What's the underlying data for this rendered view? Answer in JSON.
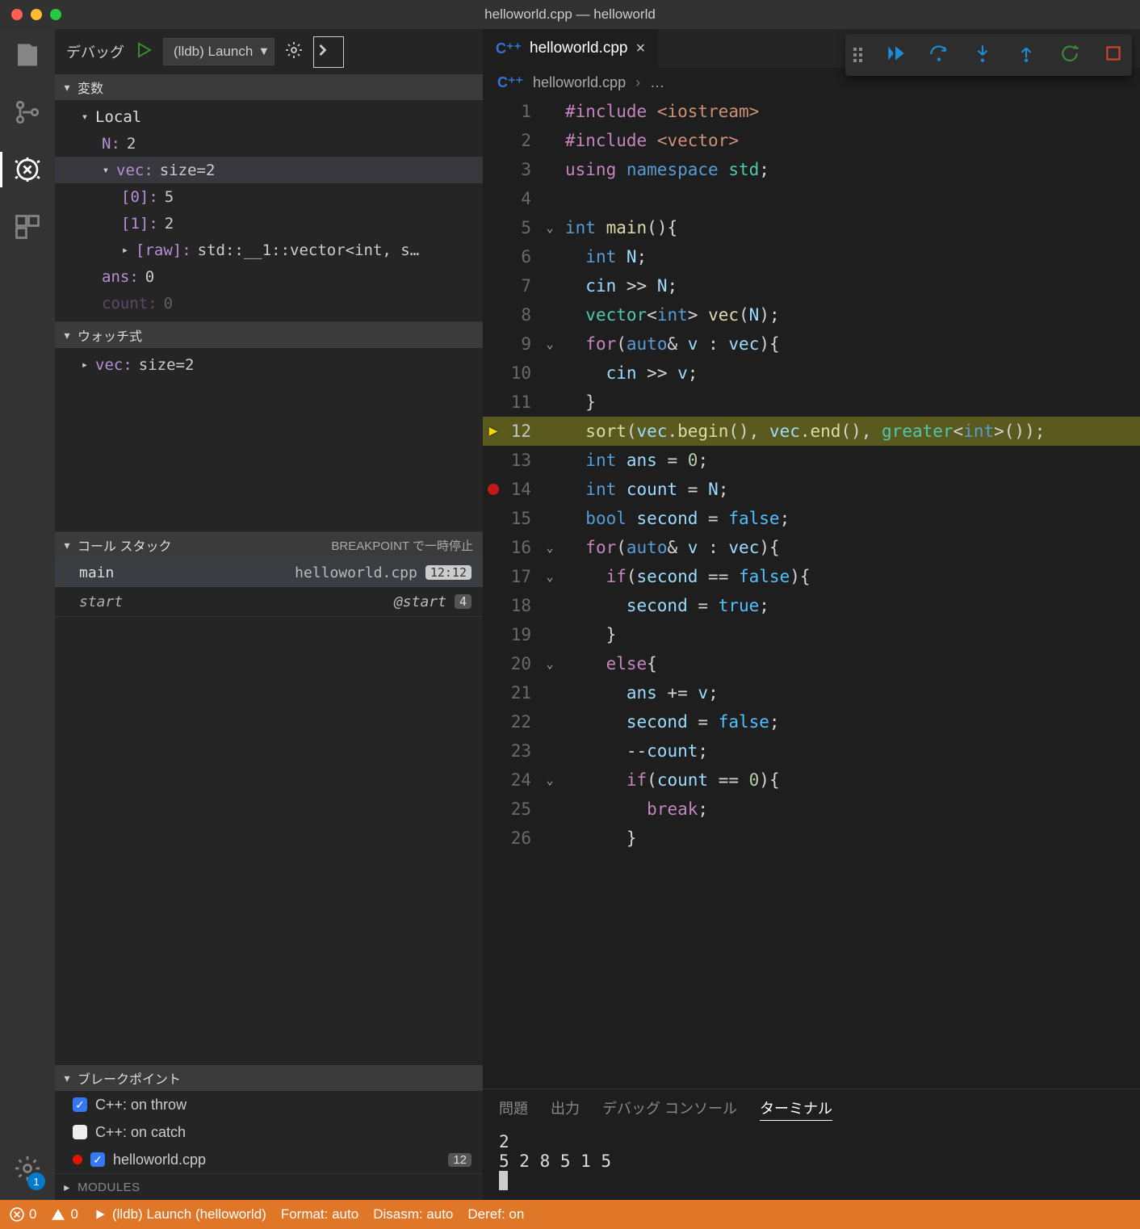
{
  "title": "helloworld.cpp — helloworld",
  "debugToolbar": {
    "label": "デバッグ",
    "config": "(lldb) Launch"
  },
  "activityBadge": "1",
  "sections": {
    "variables": "変数",
    "local": "Local",
    "watch": "ウォッチ式",
    "callstack": "コール スタック",
    "callstackRight": "BREAKPOINT で一時停止",
    "breakpoints": "ブレークポイント",
    "modules": "MODULES"
  },
  "vars": {
    "n": {
      "name": "N:",
      "val": "2"
    },
    "vec": {
      "name": "vec:",
      "val": "size=2"
    },
    "e0": {
      "name": "[0]:",
      "val": "5"
    },
    "e1": {
      "name": "[1]:",
      "val": "2"
    },
    "raw": {
      "name": "[raw]:",
      "val": "std::__1::vector<int, s…"
    },
    "ans": {
      "name": "ans:",
      "val": "0"
    },
    "count": {
      "name": "count:",
      "val": "0"
    }
  },
  "watch": {
    "vec": {
      "name": "vec:",
      "val": "size=2"
    }
  },
  "callstack": {
    "main": {
      "name": "main",
      "file": "helloworld.cpp",
      "loc": "12:12"
    },
    "start": {
      "name": "start",
      "file": "@start",
      "loc": "4"
    }
  },
  "breakpoints": {
    "throw": "C++: on throw",
    "catch": "C++: on catch",
    "file": "helloworld.cpp",
    "fileCount": "12"
  },
  "tab": {
    "name": "helloworld.cpp"
  },
  "crumbs": {
    "file": "helloworld.cpp",
    "sep": "›",
    "more": "…"
  },
  "panelTabs": {
    "problems": "問題",
    "output": "出力",
    "dbg": "デバッグ コンソール",
    "term": "ターミナル"
  },
  "terminal": {
    "l1": "2",
    "l2": "5 2 8 5 1 5"
  },
  "status": {
    "errors": "0",
    "warnings": "0",
    "launch": "(lldb) Launch (helloworld)",
    "format": "Format: auto",
    "disasm": "Disasm: auto",
    "deref": "Deref: on"
  },
  "code": {
    "1": {
      "html": "<span class='kw'>#include</span> <span class='st'>&lt;iostream&gt;</span>"
    },
    "2": {
      "html": "<span class='kw'>#include</span> <span class='st'>&lt;vector&gt;</span>"
    },
    "3": {
      "html": "<span class='kw'>using</span> <span class='ty'>namespace</span> <span class='ns'>std</span><span class='pn'>;</span>"
    },
    "4": {
      "html": ""
    },
    "5": {
      "html": "<span class='ty'>int</span> <span class='fn'>main</span><span class='pn'>(){</span>",
      "fold": true
    },
    "6": {
      "html": "  <span class='ty'>int</span> <span class='va'>N</span><span class='pn'>;</span>"
    },
    "7": {
      "html": "  <span class='va'>cin</span> <span class='op'>&gt;&gt;</span> <span class='va'>N</span><span class='pn'>;</span>"
    },
    "8": {
      "html": "  <span class='ns'>vector</span><span class='pn'>&lt;</span><span class='ty'>int</span><span class='pn'>&gt;</span> <span class='fn'>vec</span><span class='pn'>(</span><span class='va'>N</span><span class='pn'>);</span>"
    },
    "9": {
      "html": "  <span class='kw'>for</span><span class='pn'>(</span><span class='ty'>auto</span><span class='op'>&amp;</span> <span class='va'>v</span> <span class='pn'>:</span> <span class='va'>vec</span><span class='pn'>){</span>",
      "fold": true
    },
    "10": {
      "html": "    <span class='va'>cin</span> <span class='op'>&gt;&gt;</span> <span class='va'>v</span><span class='pn'>;</span>"
    },
    "11": {
      "html": "  <span class='pn'>}</span>"
    },
    "12": {
      "html": "  <span class='fn'>sort</span><span class='pn'>(</span><span class='va'>vec</span><span class='pn'>.</span><span class='fn'>begin</span><span class='pn'>(), </span><span class='va'>vec</span><span class='pn'>.</span><span class='fn'>end</span><span class='pn'>(), </span><span class='ns'>greater</span><span class='pn'>&lt;</span><span class='ty'>int</span><span class='pn'>&gt;());</span>",
      "current": true
    },
    "13": {
      "html": "  <span class='ty'>int</span> <span class='va'>ans</span> <span class='op'>=</span> <span class='nu'>0</span><span class='pn'>;</span>"
    },
    "14": {
      "html": "  <span class='ty'>int</span> <span class='va'>count</span> <span class='op'>=</span> <span class='va'>N</span><span class='pn'>;</span>",
      "bp": true
    },
    "15": {
      "html": "  <span class='ty'>bool</span> <span class='va'>second</span> <span class='op'>=</span> <span class='bl'>false</span><span class='pn'>;</span>"
    },
    "16": {
      "html": "  <span class='kw'>for</span><span class='pn'>(</span><span class='ty'>auto</span><span class='op'>&amp;</span> <span class='va'>v</span> <span class='pn'>:</span> <span class='va'>vec</span><span class='pn'>){</span>",
      "fold": true
    },
    "17": {
      "html": "    <span class='kw'>if</span><span class='pn'>(</span><span class='va'>second</span> <span class='op'>==</span> <span class='bl'>false</span><span class='pn'>){</span>",
      "fold": true
    },
    "18": {
      "html": "      <span class='va'>second</span> <span class='op'>=</span> <span class='bl'>true</span><span class='pn'>;</span>"
    },
    "19": {
      "html": "    <span class='pn'>}</span>"
    },
    "20": {
      "html": "    <span class='kw'>else</span><span class='pn'>{</span>",
      "fold": true
    },
    "21": {
      "html": "      <span class='va'>ans</span> <span class='op'>+=</span> <span class='va'>v</span><span class='pn'>;</span>"
    },
    "22": {
      "html": "      <span class='va'>second</span> <span class='op'>=</span> <span class='bl'>false</span><span class='pn'>;</span>"
    },
    "23": {
      "html": "      <span class='op'>--</span><span class='va'>count</span><span class='pn'>;</span>"
    },
    "24": {
      "html": "      <span class='kw'>if</span><span class='pn'>(</span><span class='va'>count</span> <span class='op'>==</span> <span class='nu'>0</span><span class='pn'>){</span>",
      "fold": true
    },
    "25": {
      "html": "        <span class='kw'>break</span><span class='pn'>;</span>"
    },
    "26": {
      "html": "      <span class='pn'>}</span>"
    }
  }
}
